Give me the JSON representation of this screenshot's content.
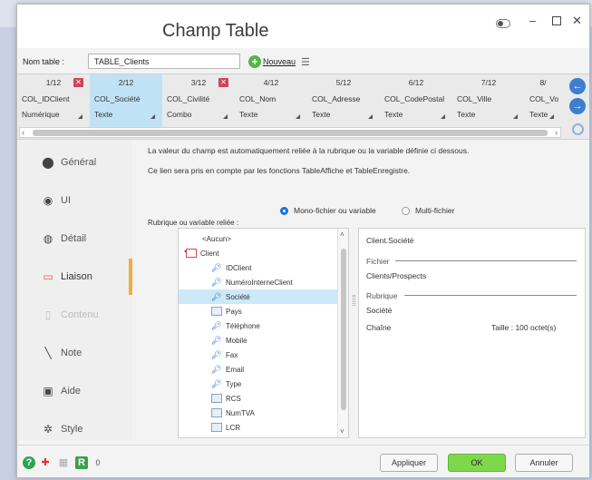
{
  "window": {
    "title": "Champ Table"
  },
  "name_row": {
    "label": "Nom table :",
    "value": "TABLE_Clients",
    "new_label": "Nouveau"
  },
  "columns": [
    {
      "num": "1/12",
      "name": "COL_IDClient",
      "type": "Numérique",
      "removable": true
    },
    {
      "num": "2/12",
      "name": "COL_Société",
      "type": "Texte",
      "selected": true
    },
    {
      "num": "3/12",
      "name": "COL_Civilité",
      "type": "Combo",
      "removable": true
    },
    {
      "num": "4/12",
      "name": "COL_Nom",
      "type": "Texte"
    },
    {
      "num": "5/12",
      "name": "COL_Adresse",
      "type": "Texte"
    },
    {
      "num": "6/12",
      "name": "COL_CodePostal",
      "type": "Texte"
    },
    {
      "num": "7/12",
      "name": "COL_Ville",
      "type": "Texte"
    },
    {
      "num": "8/",
      "name": "COL_Vo",
      "type": "Texte"
    }
  ],
  "sidebar": {
    "items": [
      {
        "label": "Général",
        "icon": "circle-icon"
      },
      {
        "label": "UI",
        "icon": "ui-icon"
      },
      {
        "label": "Détail",
        "icon": "detail-icon"
      },
      {
        "label": "Liaison",
        "icon": "link-icon",
        "active": true
      },
      {
        "label": "Contenu",
        "icon": "content-icon",
        "disabled": true
      },
      {
        "label": "Note",
        "icon": "note-icon"
      },
      {
        "label": "Aide",
        "icon": "help-icon"
      },
      {
        "label": "Style",
        "icon": "style-icon"
      }
    ]
  },
  "liaison": {
    "desc1": "La valeur du champ est automatiquement reliée à la rubrique ou la variable définie ci dessous.",
    "desc2": "Ce lien sera pris en compte par les fonctions TableAffiche et TableEnregistre.",
    "radio_mono": "Mono-fichier ou variable",
    "radio_multi": "Multi-fichier",
    "rubrique_label": "Rubrique ou variable reliée :",
    "tree": [
      {
        "label": "<Aucun>",
        "indent": 1,
        "icon": "none"
      },
      {
        "label": "Client",
        "indent": 0,
        "icon": "table",
        "expanded": true
      },
      {
        "label": "IDClient",
        "indent": 2,
        "icon": "key"
      },
      {
        "label": "NuméroInterneClient",
        "indent": 2,
        "icon": "key"
      },
      {
        "label": "Société",
        "indent": 2,
        "icon": "key",
        "selected": true
      },
      {
        "label": "Pays",
        "indent": 2,
        "icon": "field"
      },
      {
        "label": "Téléphone",
        "indent": 2,
        "icon": "key"
      },
      {
        "label": "Mobile",
        "indent": 2,
        "icon": "key"
      },
      {
        "label": "Fax",
        "indent": 2,
        "icon": "key"
      },
      {
        "label": "Email",
        "indent": 2,
        "icon": "key"
      },
      {
        "label": "Type",
        "indent": 2,
        "icon": "key"
      },
      {
        "label": "RCS",
        "indent": 2,
        "icon": "field"
      },
      {
        "label": "NumTVA",
        "indent": 2,
        "icon": "field"
      },
      {
        "label": "LCR",
        "indent": 2,
        "icon": "field"
      }
    ],
    "detail": {
      "path": "Client.Société",
      "fichier_label": "Fichier",
      "fichier_value": "Clients/Prospects",
      "rubrique_label": "Rubrique",
      "rubrique_value": "Société",
      "type": "Chaîne",
      "size": "Taille : 100 octet(s)"
    }
  },
  "bottom": {
    "counter": "0",
    "apply": "Appliquer",
    "ok": "OK",
    "cancel": "Annuler"
  }
}
